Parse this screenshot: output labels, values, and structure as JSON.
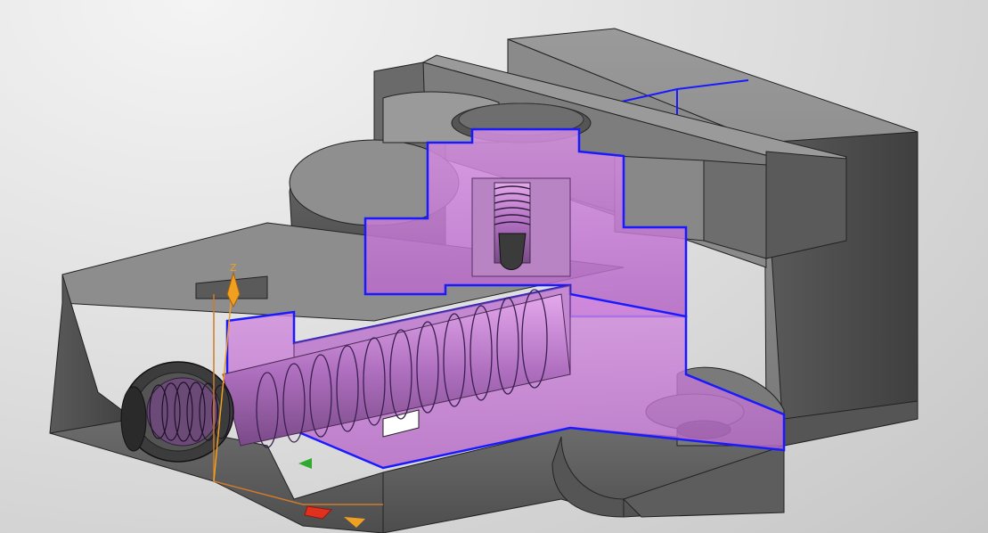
{
  "viewport": {
    "background_top": "#f2f2f2",
    "background_bottom": "#c4c4c4"
  },
  "model": {
    "body_color": "#6f6f6f",
    "body_light": "#8c8c8c",
    "body_dark": "#4c4c4c",
    "section_fill": "#c77bd6",
    "section_edge": "#1a1aff"
  },
  "triad": {
    "z_label": "Z",
    "x_color": "#e0301e",
    "y_color": "#2faa2f",
    "z_color": "#f0a020",
    "frame_color": "#d07a2a"
  }
}
